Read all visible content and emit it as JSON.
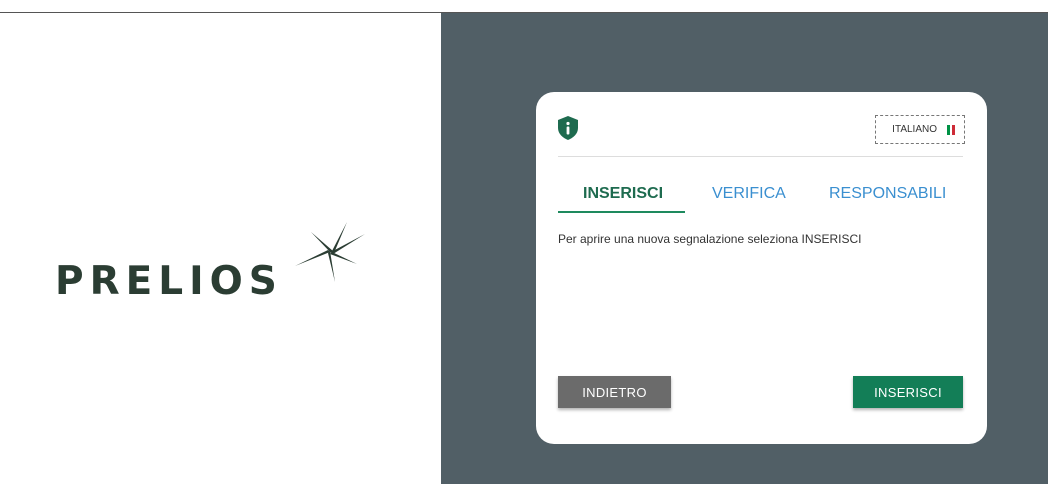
{
  "brand": {
    "logo_text": "PRELIOS"
  },
  "card": {
    "language_selector": {
      "label": "ITALIANO",
      "flag_colors": [
        "#009246",
        "#ffffff",
        "#ce2b37"
      ]
    },
    "tabs": [
      {
        "label": "INSERISCI",
        "active": true
      },
      {
        "label": "VERIFICA",
        "active": false
      },
      {
        "label": "RESPONSABILI",
        "active": false
      }
    ],
    "description": "Per aprire una nuova segnalazione seleziona INSERISCI",
    "buttons": {
      "back_label": "INDIETRO",
      "insert_label": "INSERISCI"
    }
  },
  "colors": {
    "background_panel": "#515f66",
    "accent_green": "#137e57",
    "active_tab": "#1e6b4f",
    "inactive_tab": "#3a8fd0",
    "back_button": "#6b6b6b"
  },
  "icons": {
    "card_header": "shield-info-icon",
    "logo_mark": "star-icon"
  }
}
